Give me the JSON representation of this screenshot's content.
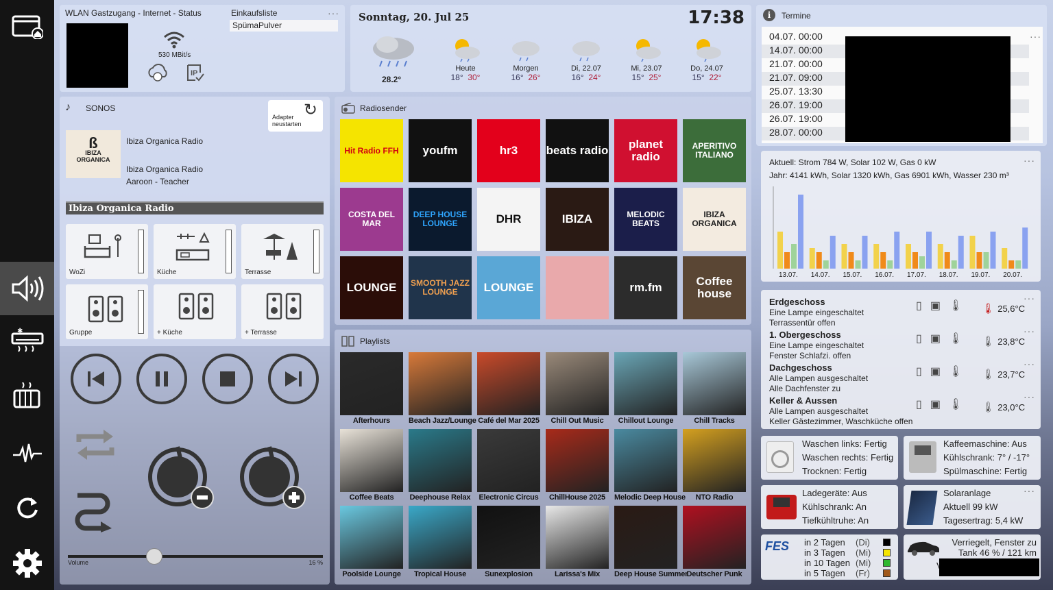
{
  "sidebar": {
    "items": [
      {
        "icon": "home-window-icon"
      },
      {
        "icon": "speaker-icon",
        "active": true
      },
      {
        "icon": "air-conditioner-icon"
      },
      {
        "icon": "heater-icon"
      },
      {
        "icon": "pulse-icon"
      },
      {
        "icon": "refresh-icon"
      },
      {
        "icon": "gear-icon"
      }
    ]
  },
  "wlan": {
    "title": "WLAN Gastzugang - Internet - Status",
    "speed": "530 MBit/s"
  },
  "shopping": {
    "title": "Einkaufsliste",
    "item": "SpümaPulver"
  },
  "weather": {
    "date": "Sonntag, 20. Jul 25",
    "time": "17:38",
    "now_temp": "28.2°",
    "days": [
      {
        "label": "Heute",
        "lo": "18°",
        "hi": "30°"
      },
      {
        "label": "Morgen",
        "lo": "16°",
        "hi": "26°"
      },
      {
        "label": "Di, 22.07",
        "lo": "16°",
        "hi": "24°"
      },
      {
        "label": "Mi, 23.07",
        "lo": "15°",
        "hi": "25°"
      },
      {
        "label": "Do, 24.07",
        "lo": "15°",
        "hi": "22°"
      }
    ]
  },
  "termine": {
    "title": "Termine",
    "rows": [
      "04.07. 00:00",
      "14.07. 00:00",
      "21.07. 00:00",
      "21.07. 09:00",
      "25.07. 13:30",
      "26.07. 19:00",
      "26.07. 19:00",
      "28.07. 00:00"
    ]
  },
  "energy": {
    "line1": "Aktuell: Strom 784 W, Solar 102 W, Gas 0 kW",
    "line2": "Jahr: 4141 kWh, Solar 1320 kWh, Gas 6901 kWh, Wasser 230 m³"
  },
  "chart_data": {
    "type": "bar",
    "categories": [
      "13.07.",
      "14.07.",
      "15.07.",
      "16.07.",
      "17.07.",
      "18.07.",
      "19.07.",
      "20.07."
    ],
    "series": [
      {
        "color": "#f2d24b",
        "values": [
          9,
          5,
          6,
          6,
          6,
          6,
          8,
          5
        ]
      },
      {
        "color": "#f08a1a",
        "values": [
          4,
          4,
          4,
          4,
          4,
          4,
          4,
          2
        ]
      },
      {
        "color": "#9fd39a",
        "values": [
          6,
          2,
          2,
          2,
          3,
          2,
          4,
          2
        ]
      },
      {
        "color": "#8aa2f0",
        "values": [
          18,
          8,
          8,
          9,
          9,
          8,
          9,
          10
        ]
      }
    ],
    "ylim": [
      0,
      20
    ]
  },
  "sonos": {
    "title": "SONOS",
    "adapter_button": "Adapter neustarten",
    "station": "Ibiza Organica Radio",
    "station2": "Ibiza Organica Radio",
    "track": "Aaroon - Teacher",
    "banner": "Ibiza Organica Radio",
    "rooms": [
      {
        "label": "WoZi",
        "level": 0.0
      },
      {
        "label": "Küche",
        "level": 0.0
      },
      {
        "label": "Terrasse",
        "level": 0.0
      },
      {
        "label": "Gruppe",
        "level": 0.0
      },
      {
        "label": "+ Küche"
      },
      {
        "label": "+ Terrasse"
      }
    ],
    "volume_label": "Volume",
    "volume_value": "16 %",
    "volume": 0.16
  },
  "radio": {
    "title": "Radiosender",
    "stations": [
      {
        "name": "Hit Radio FFH",
        "bg": "#f5e400",
        "fg": "#d10010"
      },
      {
        "name": "youfm",
        "bg": "#111",
        "fg": "#fff"
      },
      {
        "name": "hr3",
        "bg": "#e3001b",
        "fg": "#fff"
      },
      {
        "name": "beats radio",
        "bg": "#111",
        "fg": "#fff"
      },
      {
        "name": "planet radio",
        "bg": "#d01030",
        "fg": "#fff"
      },
      {
        "name": "APERITIVO ITALIANO",
        "bg": "#3c6d3a",
        "fg": "#fff"
      },
      {
        "name": "COSTA DEL MAR",
        "bg": "#9c3a8f",
        "fg": "#fff"
      },
      {
        "name": "DEEP HOUSE LOUNGE",
        "bg": "#0b1a2e",
        "fg": "#2fa6ff"
      },
      {
        "name": "DHR",
        "bg": "#f4f4f4",
        "fg": "#111"
      },
      {
        "name": "IBIZA",
        "bg": "#2a1a14",
        "fg": "#fff"
      },
      {
        "name": "MELODIC BEATS",
        "bg": "#1b1e4a",
        "fg": "#fff"
      },
      {
        "name": "IBIZA ORGANICA",
        "bg": "#f3ebe0",
        "fg": "#222"
      },
      {
        "name": "LOUNGE",
        "bg": "#2b0d08",
        "fg": "#fff"
      },
      {
        "name": "SMOOTH JAZZ LOUNGE",
        "bg": "#20344b",
        "fg": "#f0a050"
      },
      {
        "name": "LOUNGE",
        "bg": "#5aa7d6",
        "fg": "#fff"
      },
      {
        "name": "",
        "bg": "#e9a9ab",
        "fg": "#fff"
      },
      {
        "name": "rm.fm",
        "bg": "#2c2c2c",
        "fg": "#fff"
      },
      {
        "name": "Coffee house",
        "bg": "#5a4634",
        "fg": "#fff"
      }
    ]
  },
  "playlists": {
    "title": "Playlists",
    "items": [
      {
        "name": "Afterhours",
        "bg": "#2a2a2a"
      },
      {
        "name": "Beach Jazz/Lounge",
        "bg": "#d87a3a"
      },
      {
        "name": "Café del Mar 2025",
        "bg": "#c94a2a"
      },
      {
        "name": "Chill Out Music",
        "bg": "#9a8a7a"
      },
      {
        "name": "Chillout Lounge",
        "bg": "#6aa6b6"
      },
      {
        "name": "Chill Tracks",
        "bg": "#a8c8d8"
      },
      {
        "name": "Coffee Beats",
        "bg": "#e8e2d8"
      },
      {
        "name": "Deephouse Relax",
        "bg": "#2a7a8a"
      },
      {
        "name": "Electronic Circus",
        "bg": "#3a3a3a"
      },
      {
        "name": "ChillHouse 2025",
        "bg": "#a82a1a"
      },
      {
        "name": "Melodic Deep House",
        "bg": "#4a8aa0"
      },
      {
        "name": "NTO Radio",
        "bg": "#d4a020"
      },
      {
        "name": "Poolside Lounge",
        "bg": "#6ac8e0"
      },
      {
        "name": "Tropical House",
        "bg": "#3aa8c8"
      },
      {
        "name": "Sunexplosion",
        "bg": "#111"
      },
      {
        "name": "Larissa's Mix",
        "bg": "#e8e8e8"
      },
      {
        "name": "Deep House Summer",
        "bg": "#2a1a14"
      },
      {
        "name": "Deutscher Punk",
        "bg": "#b01020"
      }
    ]
  },
  "floors": [
    {
      "name": "Erdgeschoss",
      "l1": "Eine Lampe eingeschaltet",
      "l2": "Terrassentür offen",
      "temp": "25,6°C"
    },
    {
      "name": "1. Obergeschoss",
      "l1": "Eine Lampe eingeschaltet",
      "l2": "Fenster Schlafzi. offen",
      "temp": "23,8°C"
    },
    {
      "name": "Dachgeschoss",
      "l1": "Alle Lampen ausgeschaltet",
      "l2": "Alle Dachfenster zu",
      "temp": "23,7°C"
    },
    {
      "name": "Keller & Aussen",
      "l1": "Alle Lampen ausgeschaltet",
      "l2": "Keller Gästezimmer, Waschküche offen",
      "temp": "23,0°C"
    }
  ],
  "washer": {
    "l1": "Waschen links: Fertig",
    "l2": "Waschen rechts: Fertig",
    "l3": "Trocknen: Fertig"
  },
  "kitchen": {
    "l1": "Kaffeemaschine: Aus",
    "l2": "Kühlschrank: 7° / -17°",
    "l3": "Spülmaschine: Fertig"
  },
  "charger": {
    "l1": "Ladegeräte: Aus",
    "l2": "Kühlschrank: An",
    "l3": "Tiefkühltruhe: An"
  },
  "solar": {
    "l1": "Solaranlage",
    "l2": "Aktuell 99 kW",
    "l3": "Tagesertrag: 5,4 kW"
  },
  "waste": {
    "logo": "FES",
    "rows": [
      {
        "t": "in 2 Tagen",
        "d": "(Di)",
        "c": "#000"
      },
      {
        "t": "in 3 Tagen",
        "d": "(Mi)",
        "c": "#f5e400"
      },
      {
        "t": "in 10 Tagen",
        "d": "(Mi)",
        "c": "#2fb82f"
      },
      {
        "t": "in 5 Tagen",
        "d": "(Fr)",
        "c": "#a0581a"
      }
    ]
  },
  "car": {
    "l1": "Verriegelt, Fenster zu",
    "l2": "Tank 46 % / 121 km",
    "l3": "V"
  }
}
